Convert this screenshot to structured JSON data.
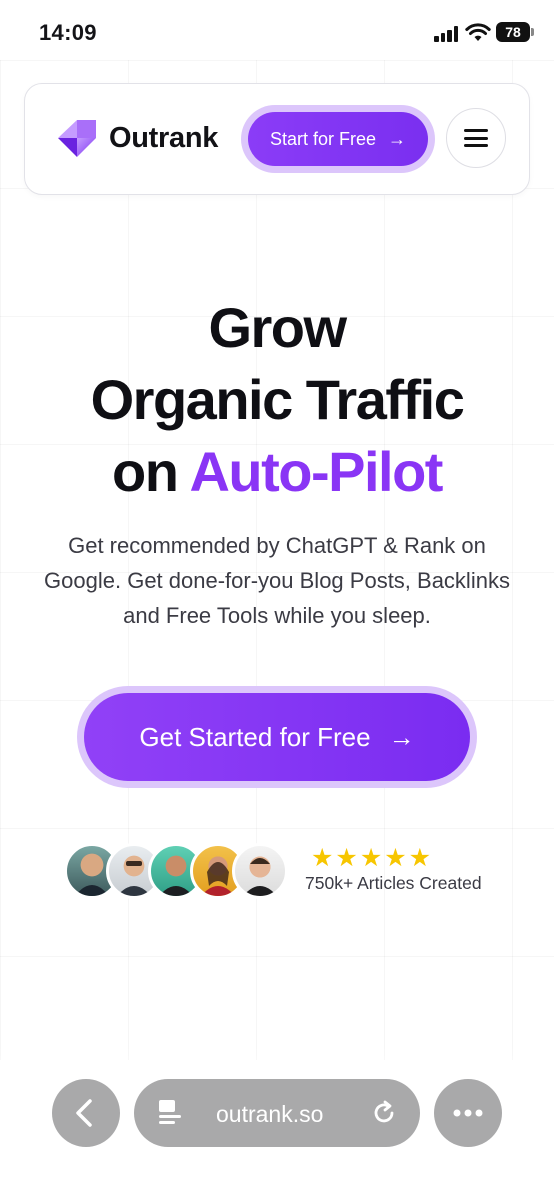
{
  "status_bar": {
    "time": "14:09",
    "battery": "78"
  },
  "header": {
    "brand": "Outrank",
    "cta_label": "Start for Free",
    "cta_arrow": "→",
    "menu_icon": "hamburger-menu-icon"
  },
  "hero": {
    "title_line1": "Grow",
    "title_line2": "Organic Traffic",
    "title_line3_prefix": "on",
    "title_line3_accent": "Auto-Pilot",
    "subtitle": "Get recommended by ChatGPT & Rank on Google. Get done-for-you Blog Posts, Backlinks and Free Tools while you sleep.",
    "cta_label": "Get Started for Free",
    "cta_arrow": "→"
  },
  "social_proof": {
    "stars": "★★★★★",
    "rating": 5,
    "text": "750k+ Articles Created"
  },
  "browser": {
    "url": "outrank.so",
    "back_icon": "chevron-left-icon",
    "reader_icon": "page-icon",
    "reload_icon": "reload-icon",
    "more_icon": "more-dots-icon"
  },
  "colors": {
    "accent": "#8a35f5",
    "cta_gradient_start": "#9141f7",
    "cta_gradient_end": "#7a2cf1",
    "cta_ring": "#dcc6fb",
    "star": "#f7c600"
  }
}
